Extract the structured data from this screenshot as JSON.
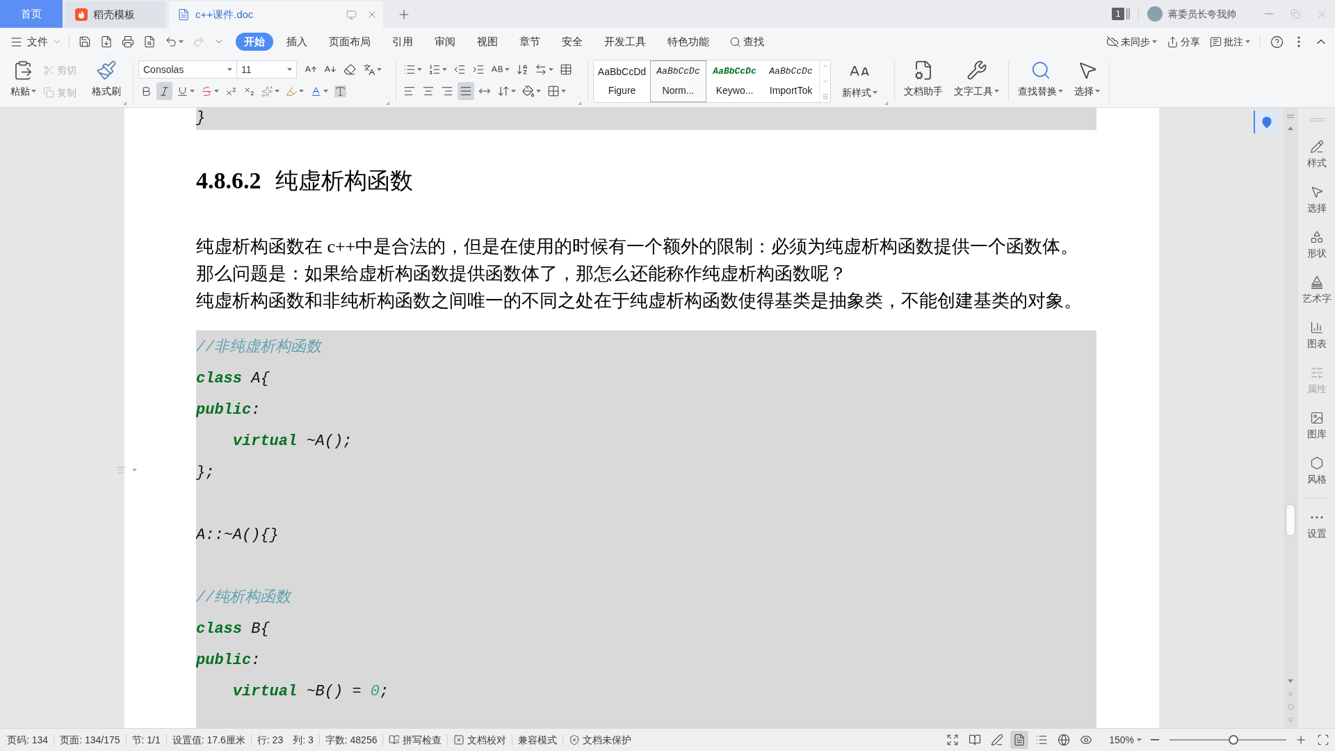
{
  "tabs": [
    {
      "kind": "home",
      "label": "首页",
      "selected": false
    },
    {
      "kind": "template",
      "label": "稻壳模板",
      "selected": false
    },
    {
      "kind": "document",
      "label": "c++课件.doc",
      "selected": true
    }
  ],
  "account": {
    "badge": "1",
    "name": "蒋委员长夸我帅"
  },
  "menu": {
    "file": "文件",
    "tabs": [
      {
        "label": "开始",
        "selected": true
      },
      {
        "label": "插入",
        "selected": false
      },
      {
        "label": "页面布局",
        "selected": false
      },
      {
        "label": "引用",
        "selected": false
      },
      {
        "label": "审阅",
        "selected": false
      },
      {
        "label": "视图",
        "selected": false
      },
      {
        "label": "章节",
        "selected": false
      },
      {
        "label": "安全",
        "selected": false
      },
      {
        "label": "开发工具",
        "selected": false
      },
      {
        "label": "特色功能",
        "selected": false
      }
    ],
    "search": "查找",
    "sync": "未同步",
    "share": "分享",
    "comment": "批注"
  },
  "ribbon": {
    "paste": "粘贴",
    "cut": {
      "label": "剪切",
      "disabled": true
    },
    "copy": {
      "label": "复制",
      "disabled": true
    },
    "format_painter": "格式刷",
    "font_name": "Consolas",
    "font_size": "11",
    "format_buttons": [
      {
        "kind": "bold",
        "selected": false
      },
      {
        "kind": "italic",
        "selected": true
      },
      {
        "kind": "underline",
        "selected": false
      },
      {
        "kind": "strikethrough",
        "selected": false
      },
      {
        "kind": "superscript",
        "selected": false
      },
      {
        "kind": "subscript",
        "selected": false
      },
      {
        "kind": "text_effect",
        "selected": false
      },
      {
        "kind": "highlight",
        "selected": false
      },
      {
        "kind": "font_color",
        "selected": false
      },
      {
        "kind": "char_shading",
        "selected": false
      }
    ],
    "align_buttons": [
      {
        "kind": "left",
        "selected": false
      },
      {
        "kind": "center",
        "selected": false
      },
      {
        "kind": "right",
        "selected": false
      },
      {
        "kind": "justify",
        "selected": true
      },
      {
        "kind": "distribute",
        "selected": false
      }
    ],
    "styles": [
      {
        "kind": "figure",
        "preview": "AaBbCcDd",
        "label": "Figure",
        "selected": false
      },
      {
        "kind": "normal",
        "preview": "AaBbCcDc",
        "label": "Norm...",
        "selected": true
      },
      {
        "kind": "keyword",
        "preview": "AaBbCcDc",
        "label": "Keywo...",
        "selected": false
      },
      {
        "kind": "import",
        "preview": "AaBbCcDc",
        "label": "ImportTok",
        "selected": false
      }
    ],
    "new_style": "新样式",
    "tool_groups": [
      {
        "tools": [
          {
            "kind": "assistant",
            "label": "文档助手",
            "dropdown": false
          },
          {
            "kind": "text_tools",
            "label": "文字工具",
            "dropdown": true
          }
        ]
      },
      {
        "tools": [
          {
            "kind": "find_replace",
            "label": "查找替换",
            "dropdown": true
          },
          {
            "kind": "select",
            "label": "选择",
            "dropdown": true
          }
        ]
      }
    ]
  },
  "document": {
    "blocks": [
      {
        "kind": "code",
        "lines": [
          {
            "kind": "code",
            "indent": false,
            "tokens": [
              {
                "kind": "normal",
                "text": "}"
              }
            ]
          }
        ]
      },
      {
        "kind": "heading",
        "number": "4.8.6.2",
        "text": "纯虚析构函数"
      },
      {
        "kind": "paragraph",
        "text": "纯虚析构函数在 c++中是合法的，但是在使用的时候有一个额外的限制：必须为纯虚析构函数提供一个函数体。"
      },
      {
        "kind": "paragraph",
        "text": "那么问题是：如果给虚析构函数提供函数体了，那怎么还能称作纯虚析构函数呢？"
      },
      {
        "kind": "paragraph",
        "text": "纯虚析构函数和非纯析构函数之间唯一的不同之处在于纯虚析构函数使得基类是抽象类，不能创建基类的对象。"
      },
      {
        "kind": "code",
        "lines": [
          {
            "kind": "code",
            "indent": false,
            "tokens": [
              {
                "kind": "comment",
                "text": "//非纯虚析构函数"
              }
            ]
          },
          {
            "kind": "code",
            "indent": false,
            "tokens": [
              {
                "kind": "keyword",
                "text": "class"
              },
              {
                "kind": "normal",
                "text": " A{"
              }
            ]
          },
          {
            "kind": "code",
            "indent": false,
            "tokens": [
              {
                "kind": "keyword",
                "text": "public"
              },
              {
                "kind": "normal",
                "text": ":"
              }
            ]
          },
          {
            "kind": "code",
            "indent": true,
            "tokens": [
              {
                "kind": "keyword",
                "text": "virtual"
              },
              {
                "kind": "normal",
                "text": " ~A();"
              }
            ]
          },
          {
            "kind": "code",
            "indent": false,
            "tokens": [
              {
                "kind": "normal",
                "text": "};"
              }
            ]
          },
          {
            "kind": "blank"
          },
          {
            "kind": "code",
            "indent": false,
            "tokens": [
              {
                "kind": "normal",
                "text": "A::~A(){}"
              }
            ]
          },
          {
            "kind": "blank"
          },
          {
            "kind": "code",
            "indent": false,
            "tokens": [
              {
                "kind": "comment",
                "text": "//纯析构函数"
              }
            ]
          },
          {
            "kind": "code",
            "indent": false,
            "tokens": [
              {
                "kind": "keyword",
                "text": "class"
              },
              {
                "kind": "normal",
                "text": " B{"
              }
            ]
          },
          {
            "kind": "code",
            "indent": false,
            "tokens": [
              {
                "kind": "keyword",
                "text": "public"
              },
              {
                "kind": "normal",
                "text": ":"
              }
            ]
          },
          {
            "kind": "code",
            "indent": true,
            "tokens": [
              {
                "kind": "keyword",
                "text": "virtual"
              },
              {
                "kind": "normal",
                "text": " ~B() = "
              },
              {
                "kind": "number",
                "text": "0"
              },
              {
                "kind": "normal",
                "text": ";"
              }
            ]
          }
        ]
      }
    ]
  },
  "sidebar": [
    {
      "kind": "style",
      "label": "样式",
      "disabled": false
    },
    {
      "kind": "select",
      "label": "选择",
      "disabled": false
    },
    {
      "kind": "shape",
      "label": "形状",
      "disabled": false
    },
    {
      "kind": "art_text",
      "label": "艺术字",
      "disabled": false
    },
    {
      "kind": "chart",
      "label": "图表",
      "disabled": false
    },
    {
      "kind": "properties",
      "label": "属性",
      "disabled": true
    },
    {
      "kind": "gallery",
      "label": "图库",
      "disabled": false
    },
    {
      "kind": "theme",
      "label": "风格",
      "disabled": false
    },
    {
      "kind": "settings",
      "label": "设置",
      "disabled": false
    }
  ],
  "status_bar": {
    "groups": [
      {
        "items": [
          {
            "kind": "text",
            "label": "页码: 134"
          }
        ]
      },
      {
        "items": [
          {
            "kind": "text",
            "label": "页面: 134/175"
          }
        ]
      },
      {
        "items": [
          {
            "kind": "text",
            "label": "节: 1/1"
          }
        ]
      },
      {
        "items": [
          {
            "kind": "text",
            "label": "设置值: 17.6厘米"
          }
        ]
      },
      {
        "items": [
          {
            "kind": "text",
            "label": "行: 23"
          },
          {
            "kind": "text",
            "label": "列: 3"
          }
        ]
      },
      {
        "items": [
          {
            "kind": "text",
            "label": "字数: 48256"
          }
        ]
      },
      {
        "items": [
          {
            "kind": "spellcheck",
            "label": "拼写检查"
          }
        ]
      },
      {
        "items": [
          {
            "kind": "proofread",
            "label": "文档校对"
          }
        ]
      },
      {
        "items": [
          {
            "kind": "text",
            "label": "兼容模式"
          }
        ]
      },
      {
        "items": [
          {
            "kind": "protection",
            "label": "文档未保护"
          }
        ]
      }
    ],
    "views": [
      {
        "kind": "focus",
        "selected": false
      },
      {
        "kind": "reading",
        "selected": false
      },
      {
        "kind": "writing",
        "selected": false
      },
      {
        "kind": "page",
        "selected": true
      },
      {
        "kind": "outline",
        "selected": false
      },
      {
        "kind": "web",
        "selected": false
      },
      {
        "kind": "eye_care",
        "selected": false
      }
    ],
    "zoom": {
      "label": "150%",
      "level": 0.55
    }
  }
}
